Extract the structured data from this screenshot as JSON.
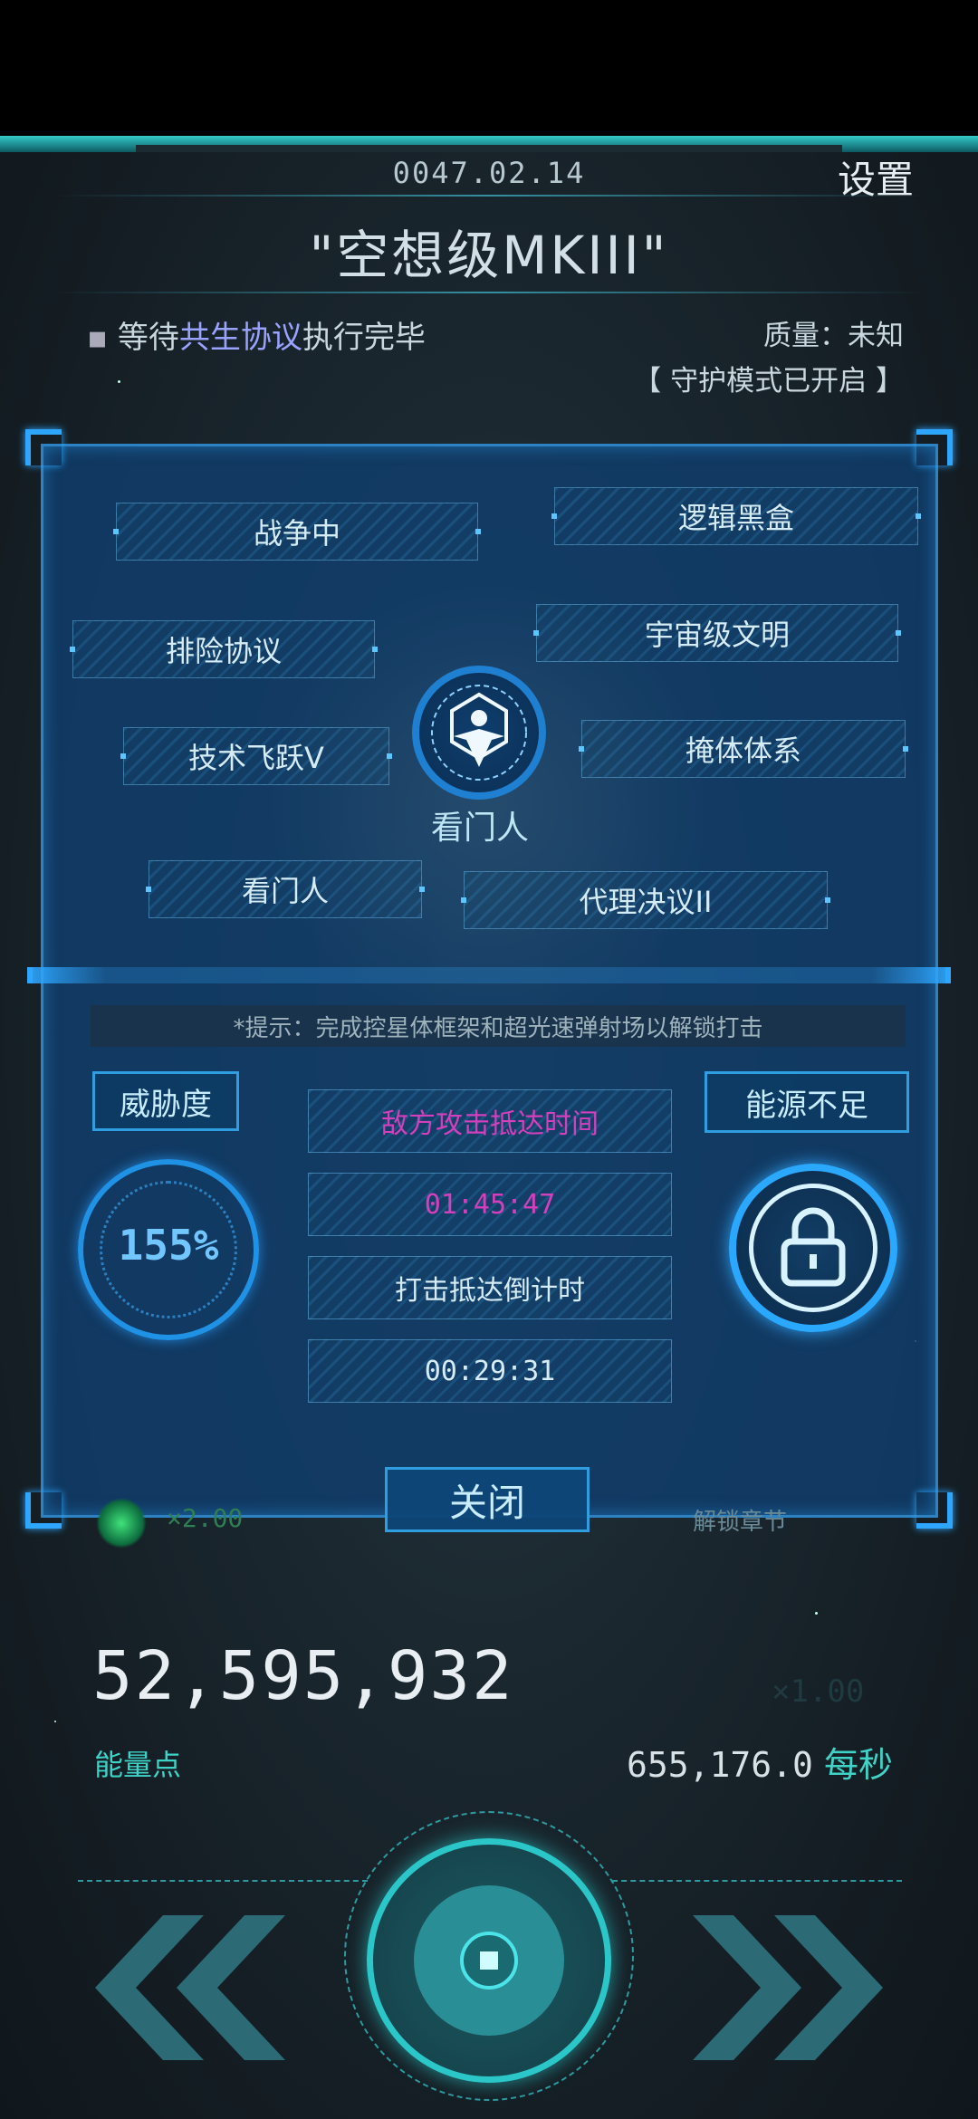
{
  "header": {
    "date": "0047.02.14",
    "settings_label": "设置",
    "title": "\"空想级MKIII\""
  },
  "status": {
    "waiting_prefix": "等待",
    "waiting_highlight": "共生协议",
    "waiting_suffix": "执行完毕",
    "quality": "质量：未知",
    "guard_mode": "【 守护模式已开启 】"
  },
  "tags": [
    "战争中",
    "逻辑黑盒",
    "排险协议",
    "宇宙级文明",
    "技术飞跃V",
    "掩体体系",
    "看门人",
    "代理决议II"
  ],
  "emblem": {
    "label": "看门人"
  },
  "hint": "*提示：完成控星体框架和超光速弹射场以解锁打击",
  "threat": {
    "label": "威胁度",
    "value": "155%"
  },
  "energy_status": {
    "label": "能源不足"
  },
  "timers": {
    "enemy_arrival_label": "敌方攻击抵达时间",
    "enemy_arrival_time": "01:45:47",
    "strike_countdown_label": "打击抵达倒计时",
    "strike_countdown_time": "00:29:31"
  },
  "close_label": "关闭",
  "background_hints": {
    "multiplier_left": "×2.00",
    "unlock_chapter": "解锁章节",
    "multiplier_right": "×1.00"
  },
  "resources": {
    "energy_points": "52,595,932",
    "energy_points_label": "能量点",
    "rate": "655,176.0",
    "rate_unit": "每秒"
  },
  "colors": {
    "accent_cyan": "#2ec9c9",
    "panel_blue": "#1a4a7a",
    "highlight_purple": "#9aa2ff",
    "timer_magenta": "#d03ab8"
  }
}
